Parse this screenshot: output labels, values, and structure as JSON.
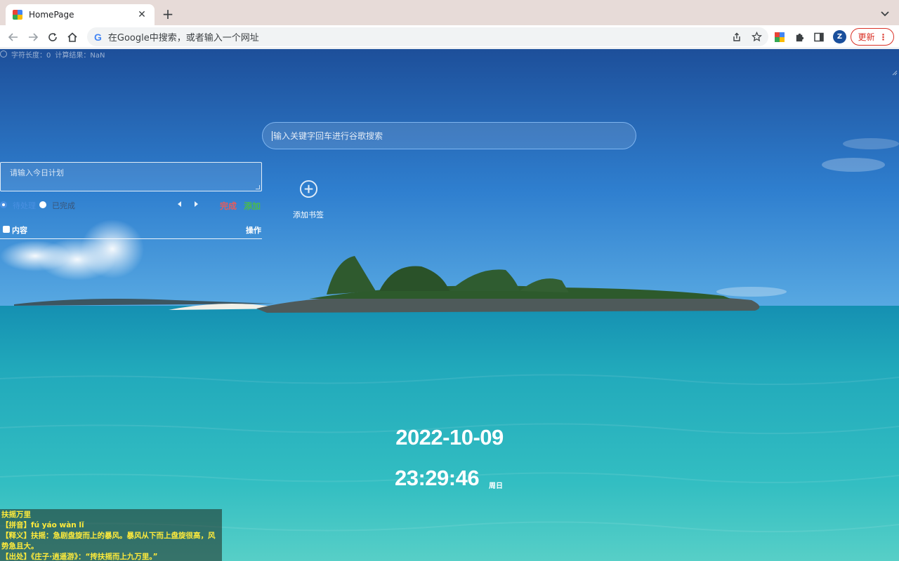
{
  "browser": {
    "tab": {
      "title": "HomePage",
      "close_icon": "close-icon"
    },
    "new_tab_label": "+",
    "omnibox": {
      "text": "在Google中搜索，或者输入一个网址",
      "google_glyph": "G"
    },
    "profile_initial": "Z",
    "update_button": "更新",
    "colors": {
      "tabstrip": "#e7dbd8",
      "update": "#d93025",
      "avatar": "#1a4f9c"
    }
  },
  "page": {
    "top_bar": {
      "char_length": "字符长度：0",
      "calc_result": "计算结果：NaN"
    },
    "search": {
      "placeholder": "输入关键字回车进行谷歌搜索"
    },
    "todo": {
      "input_placeholder": "请输入今日计划",
      "filter_pending": "待处理",
      "filter_done": "已完成",
      "selected_filter": "待处理",
      "complete_button": "完成",
      "add_button": "添加",
      "columns": {
        "content": "内容",
        "operations": "操作"
      }
    },
    "bookmark": {
      "add_label": "添加书签"
    },
    "clock": {
      "date": "2022-10-09",
      "time": "23:29:46",
      "weekday": "周日"
    },
    "idiom": {
      "title": "扶摇万里",
      "pinyin": "【拼音】fú yáo wàn lǐ",
      "meaning": "【释义】扶摇：急剧盘旋而上的暴风。暴风从下而上盘旋很高，风势急且大。",
      "source": "【出处】《庄子·逍遥游》：“抟扶摇而上九万里。”"
    },
    "colors": {
      "complete": "#e65c5c",
      "add": "#4cbb4c",
      "pending": "#4a90e2",
      "idiom_text": "#ffeb3b"
    }
  }
}
